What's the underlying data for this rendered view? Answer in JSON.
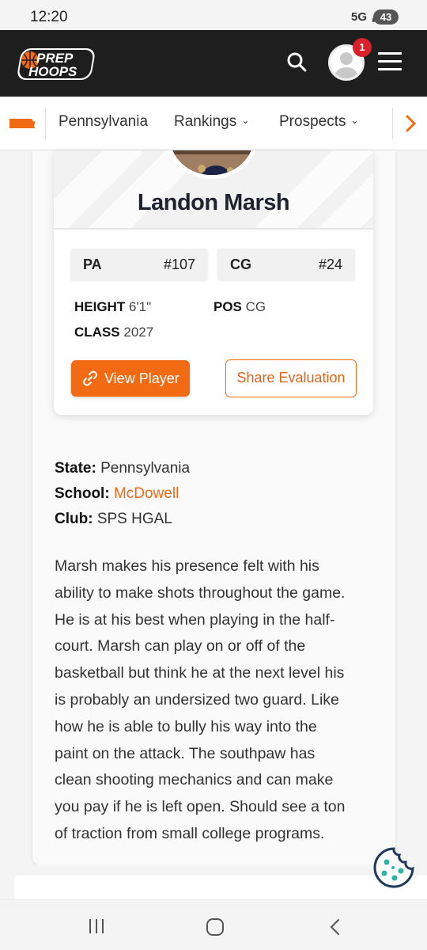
{
  "status_bar": {
    "time": "12:20",
    "network": "5G",
    "battery": "43"
  },
  "header": {
    "logo_text": "PREP HOOPS",
    "notification_count": "1",
    "colors": {
      "background": "#1e1e1e",
      "accent": "#f26a14"
    }
  },
  "subnav": {
    "items": [
      {
        "label": "Pennsylvania",
        "has_dropdown": false
      },
      {
        "label": "Rankings",
        "has_dropdown": true
      },
      {
        "label": "Prospects",
        "has_dropdown": true
      }
    ],
    "next_icon": "chevron-right-icon"
  },
  "player_card": {
    "name": "Landon Marsh",
    "ranks": [
      {
        "label": "PA",
        "value": "#107"
      },
      {
        "label": "CG",
        "value": "#24"
      }
    ],
    "height_label": "HEIGHT",
    "height": "6'1\"",
    "pos_label": "POS",
    "pos": "CG",
    "class_label": "CLASS",
    "class": "2027",
    "view_button": "View Player",
    "share_button": "Share Evaluation"
  },
  "info": {
    "state_label": "State:",
    "state": "Pennsylvania",
    "school_label": "School:",
    "school": "McDowell",
    "club_label": "Club:",
    "club": "SPS HGAL"
  },
  "evaluation": {
    "lines": [
      "Marsh makes his presence felt with his",
      "ability to make shots throughout the game.",
      "He is at his best when playing in the half-",
      "court. Marsh can play on or off of the",
      "basketball but think he at the next level his",
      "is probably an undersized two guard. Like",
      "how he is able to bully his way into the",
      "paint on the attack. The southpaw has",
      "clean shooting mechanics and can make",
      "you pay if he is left open. Should see a ton",
      "of traction from small college programs."
    ]
  }
}
